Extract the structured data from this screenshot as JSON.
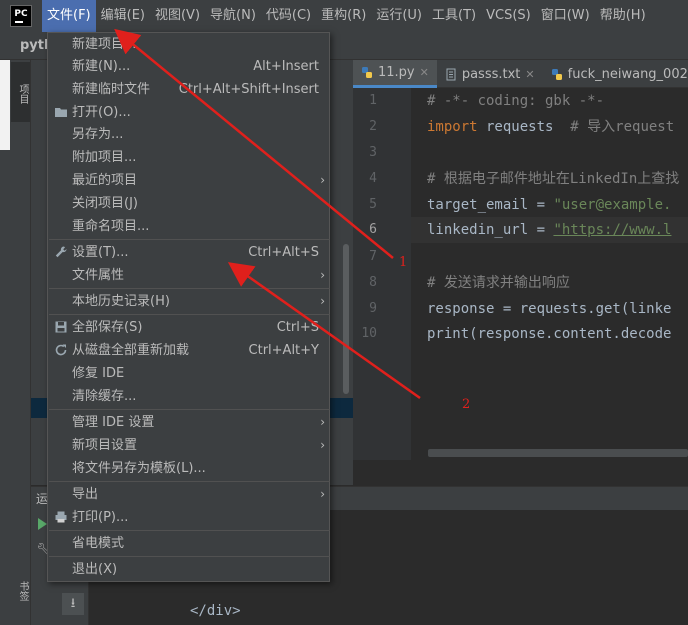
{
  "menubar": {
    "logo": "PC",
    "items": [
      {
        "label": "文件(F)",
        "active": true
      },
      {
        "label": "编辑(E)"
      },
      {
        "label": "视图(V)"
      },
      {
        "label": "导航(N)"
      },
      {
        "label": "代码(C)"
      },
      {
        "label": "重构(R)"
      },
      {
        "label": "运行(U)"
      },
      {
        "label": "工具(T)"
      },
      {
        "label": "VCS(S)"
      },
      {
        "label": "窗口(W)"
      },
      {
        "label": "帮助(H)"
      }
    ]
  },
  "project": {
    "crumb": "pyth",
    "tool_label": "项目",
    "bookmarks_label": "书签"
  },
  "tabs": [
    {
      "label": "11.py",
      "active": true,
      "icon": "python-file-icon"
    },
    {
      "label": "passs.txt",
      "icon": "text-file-icon"
    },
    {
      "label": "fuck_neiwang_002.",
      "icon": "python-file-icon"
    }
  ],
  "editor": {
    "line_numbers": [
      "1",
      "2",
      "3",
      "4",
      "5",
      "6",
      "7",
      "8",
      "9",
      "10"
    ],
    "current_line": 6,
    "lines": [
      {
        "n": "1",
        "text": "# -*- coding: gbk -*-"
      },
      {
        "n": "2",
        "kw": "import",
        "rest": " requests  ",
        "comment": "# 导入request"
      },
      {
        "n": "3",
        "text": ""
      },
      {
        "n": "4",
        "text": "# 根据电子邮件地址在LinkedIn上查找"
      },
      {
        "n": "5",
        "var": "target_email = ",
        "str": "\"user@example."
      },
      {
        "n": "6",
        "var": "linkedin_url = ",
        "str": "\"https://www.l"
      },
      {
        "n": "7",
        "text": ""
      },
      {
        "n": "8",
        "text": "# 发送请求并输出响应"
      },
      {
        "n": "9",
        "code": "response = requests.get(linke"
      },
      {
        "n": "10",
        "code": "print(response.content.decode"
      }
    ]
  },
  "run_panel": {
    "label": "运",
    "output_text": "</div>"
  },
  "file_menu": {
    "items": [
      {
        "label": "新建项目...",
        "shortcut": ""
      },
      {
        "label": "新建(N)...",
        "shortcut": "Alt+Insert"
      },
      {
        "label": "新建临时文件",
        "shortcut": "Ctrl+Alt+Shift+Insert"
      },
      {
        "label": "打开(O)...",
        "shortcut": "",
        "icon": "folder-icon"
      },
      {
        "label": "另存为...",
        "shortcut": ""
      },
      {
        "label": "附加项目...",
        "shortcut": ""
      },
      {
        "label": "最近的项目",
        "shortcut": "",
        "submenu": true
      },
      {
        "label": "关闭项目(J)",
        "shortcut": ""
      },
      {
        "label": "重命名项目...",
        "shortcut": ""
      },
      {
        "label": "设置(T)...",
        "shortcut": "Ctrl+Alt+S",
        "icon": "wrench-icon"
      },
      {
        "label": "文件属性",
        "shortcut": "",
        "submenu": true
      },
      {
        "label": "本地历史记录(H)",
        "shortcut": "",
        "submenu": true
      },
      {
        "label": "全部保存(S)",
        "shortcut": "Ctrl+S",
        "icon": "save-icon"
      },
      {
        "label": "从磁盘全部重新加载",
        "shortcut": "Ctrl+Alt+Y",
        "icon": "reload-icon"
      },
      {
        "label": "修复 IDE",
        "shortcut": ""
      },
      {
        "label": "清除缓存...",
        "shortcut": ""
      },
      {
        "label": "管理 IDE 设置",
        "shortcut": "",
        "submenu": true
      },
      {
        "label": "新项目设置",
        "shortcut": "",
        "submenu": true
      },
      {
        "label": "将文件另存为模板(L)...",
        "shortcut": ""
      },
      {
        "label": "导出",
        "shortcut": "",
        "submenu": true
      },
      {
        "label": "打印(P)...",
        "shortcut": "",
        "icon": "print-icon"
      },
      {
        "label": "省电模式",
        "shortcut": ""
      },
      {
        "label": "退出(X)",
        "shortcut": ""
      }
    ]
  },
  "annotations": {
    "label_1": "1",
    "label_2": "2",
    "color": "#e0201c"
  }
}
